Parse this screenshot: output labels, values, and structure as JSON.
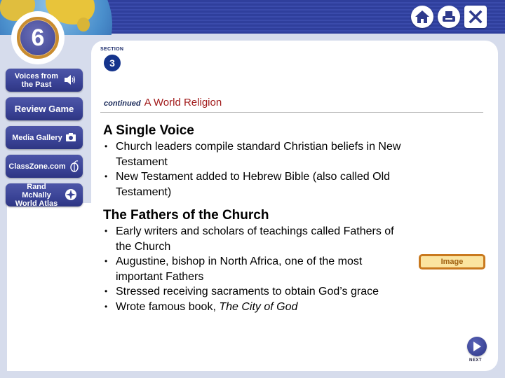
{
  "header": {
    "chapter_number": "6",
    "controls": [
      {
        "name": "home-icon",
        "label": "Home"
      },
      {
        "name": "print-icon",
        "label": "Print"
      },
      {
        "name": "close-icon",
        "label": "Close"
      }
    ]
  },
  "sidebar": {
    "items": [
      {
        "label": "Voices from the Past",
        "icon": "speaker-icon",
        "glyph": "🔊"
      },
      {
        "label": "Review Game",
        "icon": "",
        "glyph": ""
      },
      {
        "label": "Media Gallery",
        "icon": "camera-icon",
        "glyph": "📷"
      },
      {
        "label": "ClassZone.com",
        "icon": "globe-mouse-icon",
        "glyph": "🖱"
      },
      {
        "label": "Rand McNally World Atlas",
        "icon": "atlas-icon",
        "glyph": "✺"
      }
    ]
  },
  "section": {
    "label": "SECTION",
    "number": "3"
  },
  "topic": {
    "continued": "continued",
    "title": "A World Religion"
  },
  "content": {
    "blocks": [
      {
        "heading": "A Single Voice",
        "bullets": [
          "Church leaders compile standard Christian beliefs in New Testament",
          "New Testament added to Hebrew Bible (also called Old Testament)"
        ]
      },
      {
        "heading": "The Fathers of the Church",
        "bullets": [
          "Early writers and scholars of teachings called Fathers of the Church",
          "Augustine, bishop in North Africa, one of the most important Fathers",
          "Stressed receiving sacraments to obtain God’s grace"
        ],
        "last_bullet_prefix": "Wrote famous book, ",
        "last_bullet_italic": "The City of God"
      }
    ]
  },
  "buttons": {
    "image_label": "Image",
    "next_label": "NEXT"
  },
  "colors": {
    "banner": "#2f3f9c",
    "sidebar_button": "#3a4396",
    "topic_title": "#a11a1a",
    "section_badge": "#15348c",
    "image_button_border": "#c9791e",
    "image_button_fill": "#fbe4a0"
  }
}
